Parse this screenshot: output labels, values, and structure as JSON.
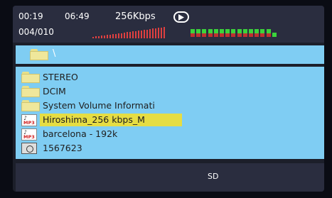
{
  "player": {
    "elapsed_time": "00:19",
    "total_time": "06:49",
    "track_position": "004/010",
    "bitrate": "256Kbps",
    "state_icon": "play-icon",
    "colors": {
      "accent_red": "#e04040",
      "level_green": "#3bd43b",
      "highlight": "#e6dd43",
      "panel": "#7fcdf3"
    }
  },
  "browser": {
    "current_path": "\\",
    "items": [
      {
        "label": "STEREO",
        "type": "folder",
        "icon": "folder-icon"
      },
      {
        "label": "DCIM",
        "type": "folder",
        "icon": "folder-icon"
      },
      {
        "label": "System Volume Informati",
        "type": "folder",
        "icon": "folder-icon"
      },
      {
        "label": "Hiroshima_256 kbps_M",
        "type": "mp3",
        "icon": "mp3-file-icon",
        "selected": true
      },
      {
        "label": "barcelona - 192k",
        "type": "mp3",
        "icon": "mp3-file-icon"
      },
      {
        "label": "1567623",
        "type": "photo",
        "icon": "photo-file-icon"
      }
    ]
  },
  "footer": {
    "storage_label": "SD"
  },
  "icon_text": {
    "mp3": "MP3",
    "note": "♪"
  }
}
